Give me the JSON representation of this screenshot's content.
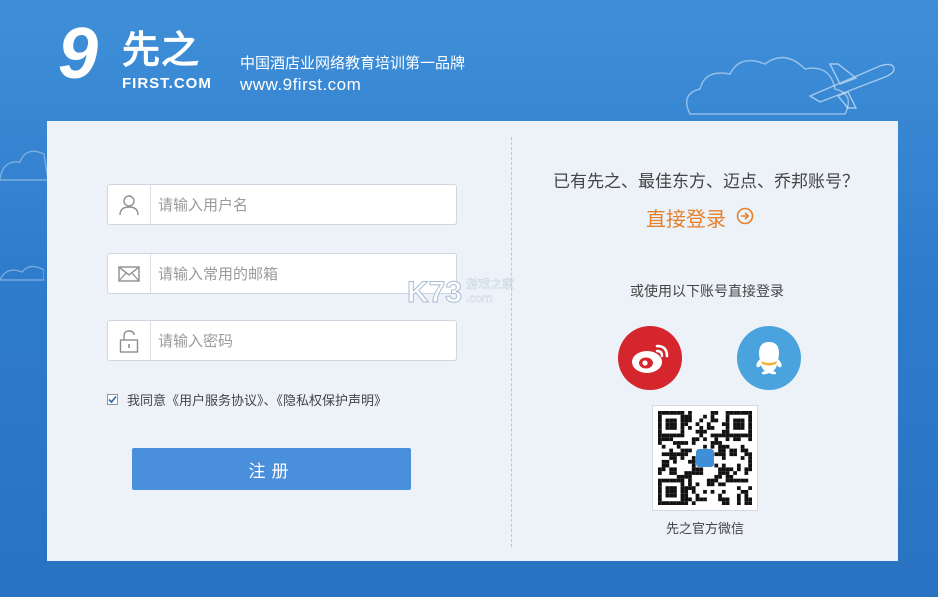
{
  "brand": {
    "logo_nine": "9",
    "logo_cn": "先之",
    "logo_en": "FIRST.COM",
    "slogan": "中国酒店业网络教育培训第一品牌",
    "url": "www.9first.com"
  },
  "form": {
    "username_placeholder": "请输入用户名",
    "email_placeholder": "请输入常用的邮箱",
    "password_placeholder": "请输入密码",
    "agree_prefix": "我同意",
    "agree_terms": "《用户服务协议》",
    "agree_sep": "、",
    "agree_privacy": "《隐私权保护声明》",
    "agree_checked": true,
    "register_label": "注册"
  },
  "right": {
    "existing_account": "已有先之、最佳东方、迈点、乔邦账号？",
    "direct_login": "直接登录",
    "alt_login": "或使用以下账号直接登录",
    "qr_caption": "先之官方微信"
  },
  "watermark": {
    "main": "K73",
    "cn": "游戏之家",
    "com": ".com"
  },
  "colors": {
    "background": "#2f7ccc",
    "panel": "#edf2f8",
    "register_button": "#4a8fdb",
    "direct_login": "#e6802a",
    "weibo": "#d5262d",
    "qq": "#4aa3dd"
  },
  "icons": {
    "username": "user-icon",
    "email": "envelope-icon",
    "password": "lock-icon",
    "direct_login": "arrow-right-circle-icon",
    "weibo": "weibo-icon",
    "qq": "qq-icon"
  }
}
